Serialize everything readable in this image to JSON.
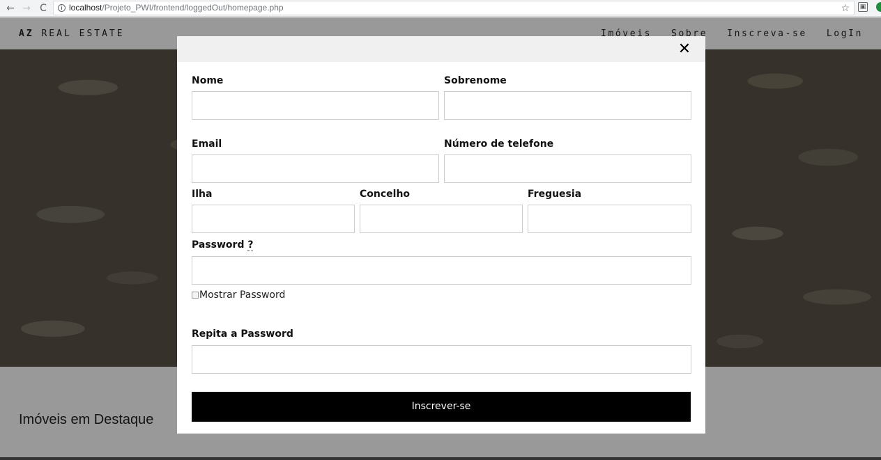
{
  "browser": {
    "back_icon": "←",
    "forward_icon": "→",
    "reload_icon": "C",
    "url_host": "localhost",
    "url_path": "/Projeto_PWI/frontend/loggedOut/homepage.php",
    "star_icon": "☆"
  },
  "header": {
    "brand_bold": "AZ",
    "brand_rest": " REAL ESTATE",
    "nav": [
      "Imóveis",
      "Sobre",
      "Inscreva-se",
      "LogIn"
    ]
  },
  "main": {
    "featured_title": "Imóveis em Destaque"
  },
  "modal": {
    "close_icon": "✕",
    "fields": {
      "nome": {
        "label": "Nome",
        "value": ""
      },
      "sobrenome": {
        "label": "Sobrenome",
        "value": ""
      },
      "email": {
        "label": "Email",
        "value": ""
      },
      "telefone": {
        "label": "Número de telefone",
        "value": ""
      },
      "ilha": {
        "label": "Ilha",
        "value": ""
      },
      "concelho": {
        "label": "Concelho",
        "value": ""
      },
      "freguesia": {
        "label": "Freguesia",
        "value": ""
      },
      "password": {
        "label": "Password",
        "help": "?",
        "value": ""
      },
      "repeat_password": {
        "label": "Repita a Password",
        "value": ""
      }
    },
    "show_password_label": "Mostrar Password",
    "submit_label": "Inscrever-se"
  }
}
